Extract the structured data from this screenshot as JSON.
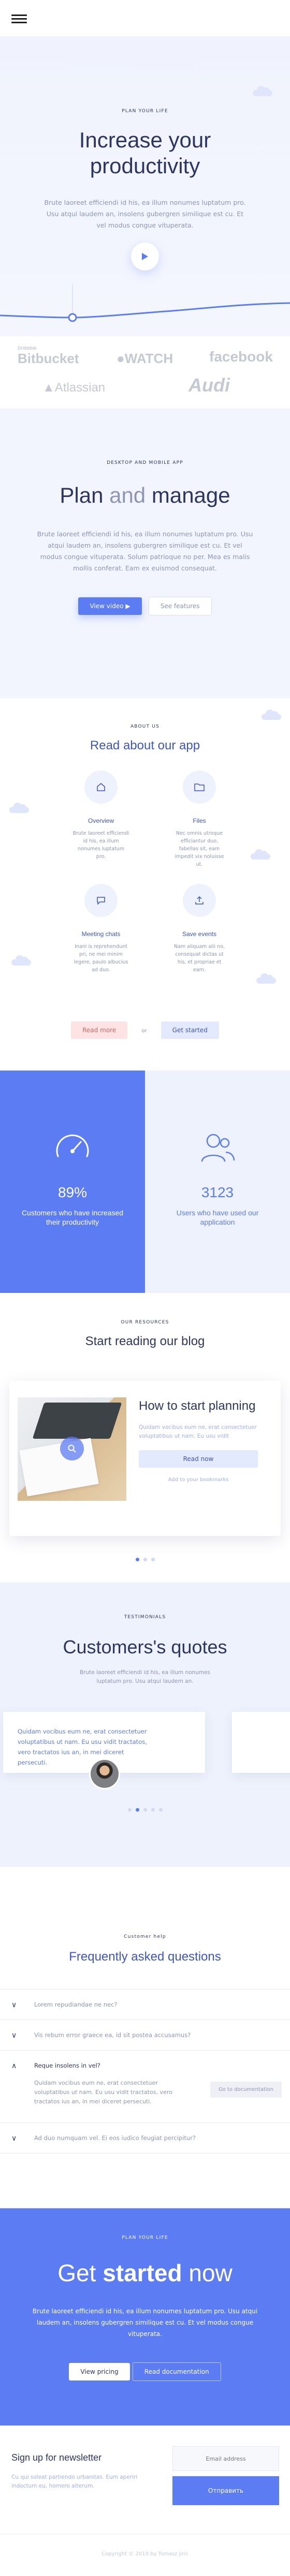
{
  "hero": {
    "kicker": "PLAN YOUR LIFE",
    "title_line1": "Increase your",
    "title_line2": "productivity",
    "text": "Brute laoreet efficiendi id his, ea illum nonumes luptatum pro. Usu atqui laudem an, insolens gubergren similique est cu. Et vel modus congue vituperata."
  },
  "logos": [
    "Dribbble",
    "Bitbucket",
    "WATCH",
    "facebook",
    "Atlassian",
    "Audi"
  ],
  "plan": {
    "kicker": "DESKTOP AND MOBILE APP",
    "title_a": "Plan",
    "title_and": " and ",
    "title_b": "manage",
    "text": "Brute laoreet efficiendi id his, ea illum nonumes luptatum pro. Usu atqui laudem an, insolens gubergren similique est cu. Et vel modus congue vituperata. Solum patrioque no per. Mea es malis mollis conferat. Eam ex euismod consequat.",
    "btn_video": "View video",
    "btn_features": "See features"
  },
  "about": {
    "kicker": "ABOUT US",
    "title": "Read about our app",
    "features": [
      {
        "title": "Overview",
        "text": "Brute laoreet efficiendi id his, ea illum nonumes luptatum pro."
      },
      {
        "title": "Files",
        "text": "Nec omnis utroque efficiantur duo, fabellas sit, eam impedit vix noluisse ut."
      },
      {
        "title": "Meeting chats",
        "text": "Inani is reprehendunt pri, ne mei minim legere, paulo albucius ad duo."
      },
      {
        "title": "Save events",
        "text": "Nam aliquam alii no, consequat dictas ut his, et propriae et eam."
      }
    ],
    "btn_read": "Read more",
    "or": "or",
    "btn_start": "Get started"
  },
  "stats": [
    {
      "value": "89%",
      "label": "Customers who have increased their productivity"
    },
    {
      "value": "3123",
      "label": "Users who have used our application"
    }
  ],
  "blog": {
    "kicker": "OUR RESOURCES",
    "title": "Start reading our blog",
    "post_title": "How to start planning",
    "post_text": "Quidam vocibus eum ne, erat consectetuer voluptatibus ut nam. Eu usu vidit",
    "btn_read": "Read now",
    "bookmark": "Add to your bookmarks"
  },
  "testimonials": {
    "kicker": "TESTIMONIALS",
    "title": "Customers's quotes",
    "sub": "Brute laoreet efficiendi id his, ea illum nonumes luptatum pro. Usu atqui laudem an.",
    "quote": "Quidam vocibus eum ne, erat consectetuer voluptatibus ut nam. Eu usu vidit tractatos, vero tractatos ius an, in mei diceret persecuti."
  },
  "faq": {
    "kicker": "Customer help",
    "title": "Frequently asked questions",
    "items": [
      {
        "q": "Lorem repudiandae ne nec?"
      },
      {
        "q": "Vis rebum error graece ea, id sit postea accusamus?"
      },
      {
        "q": "Reque insolens in vel?",
        "a": "Quidam vocibus eum ne, erat consectetuer voluptatibus ut nam. Eu usu vidit tractatos, vero tractatos ius an, in mei diceret persecuti.",
        "btn": "Go to documentation"
      },
      {
        "q": "Ad duo numquam vel. Ei eos iudico feugiat percipitur?"
      }
    ]
  },
  "cta": {
    "kicker": "PLAN YOUR LIFE",
    "title_a": "Get ",
    "title_b": "started",
    "title_c": " now",
    "text": "Brute laoreet efficiendi id his, ea illum nonumes luptatum pro. Usu atqui laudem an, insolens gubergren similique est cu. Et vel modus congue vituperata.",
    "btn_pricing": "View pricing",
    "btn_docs": "Read documentation"
  },
  "newsletter": {
    "title": "Sign up for newsletter",
    "text": "Cu qui soleat partiendo urbanitas. Eum aperiri indoctum eu, homero alterum.",
    "placeholder": "Email address",
    "submit": "Отправить"
  },
  "footer": {
    "copyright": "Copyright © 2019 by Tomasz Jiric"
  },
  "colors": {
    "primary": "#5c7cf4",
    "dark": "#2d3561",
    "pale": "#eef2fd"
  }
}
